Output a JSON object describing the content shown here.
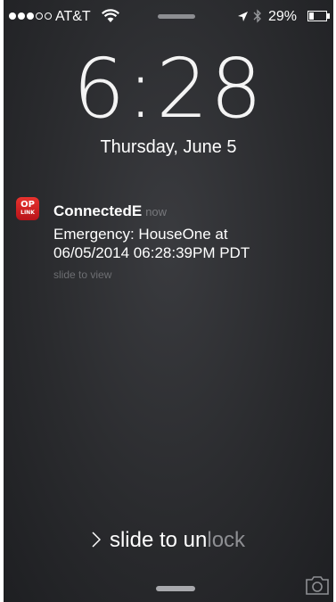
{
  "status_bar": {
    "carrier": "AT&T",
    "battery": "29%",
    "battery_fraction": 0.29,
    "signal_bars_filled": 3,
    "signal_bars_total": 5,
    "icons": [
      "wifi-icon",
      "location-icon",
      "bluetooth-icon",
      "battery-icon"
    ]
  },
  "lock_screen": {
    "time": "6:28",
    "date": "Thursday, June 5"
  },
  "notification": {
    "app_icon_text_top": "OP",
    "app_icon_text_bottom": "LINK",
    "app_name": "ConnectedE",
    "time": "now",
    "message": "Emergency: HouseOne at\n06/05/2014 06:28:39PM PDT",
    "action": "slide to view",
    "icon_color": "#d6222a"
  },
  "unlock": {
    "label": "slide to unlock"
  },
  "colors": {
    "background": "#2c2d30",
    "text": "#ffffff",
    "muted": "#77787c"
  }
}
